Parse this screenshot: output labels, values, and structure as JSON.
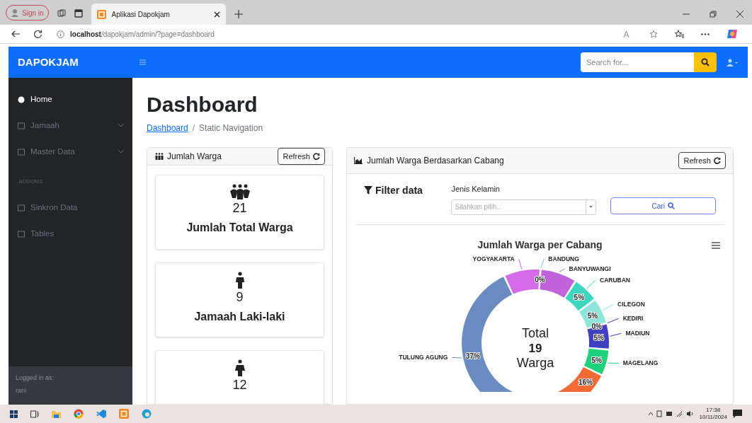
{
  "browser": {
    "sign_in": "Sign in",
    "tab_title": "Aplikasi Dapokjam",
    "url_host": "localhost",
    "url_path": "/dapokjam/admin/?page=dashboard"
  },
  "navbar": {
    "brand": "DAPOKJAM",
    "search": {
      "placeholder": "Search for..."
    }
  },
  "sidebar": {
    "items": [
      {
        "kind": "link",
        "label": "Home",
        "selected": true
      },
      {
        "kind": "collapse",
        "label": "Jamaah",
        "selected": false
      },
      {
        "kind": "collapse",
        "label": "Master Data",
        "selected": false
      },
      {
        "kind": "heading",
        "label": "ADDONS"
      },
      {
        "kind": "link",
        "label": "Sinkron Data",
        "selected": false
      },
      {
        "kind": "link",
        "label": "Tables",
        "selected": false
      }
    ],
    "footer": {
      "caption": "Logged in as:",
      "user": "rani"
    }
  },
  "page": {
    "title": "Dashboard",
    "breadcrumb_separator": "/",
    "breadcrumb": [
      {
        "label": "Dashboard",
        "kind": "link"
      },
      {
        "label": "Static Navigation",
        "kind": "current"
      }
    ]
  },
  "warga_card": {
    "title": "Jumlah Warga",
    "refresh": "Refresh",
    "stats": [
      {
        "kind": "group",
        "value": "21",
        "label": "Jumlah Total Warga"
      },
      {
        "kind": "male",
        "value": "9",
        "label": "Jamaah Laki-laki"
      },
      {
        "kind": "female",
        "value": "12"
      }
    ]
  },
  "cabang_card": {
    "title": "Jumlah Warga Berdasarkan Cabang",
    "refresh": "Refresh",
    "filter": {
      "heading": "Filter data",
      "field_label": "Jenis Kelamin",
      "placeholder": "Silahkan pilih..",
      "button": "Cari"
    },
    "chart_data": {
      "type": "donut",
      "title": "Jumlah Warga per Cabang",
      "categories": [
        "TULUNG AGUNG",
        "YOGYAKARTA",
        "BANDUNG",
        "BANYUWANGI",
        "CARUBAN",
        "CILEGON",
        "KEDIRI",
        "MADIUN",
        "MAGELANG",
        null
      ],
      "values": [
        37,
        7,
        0,
        7,
        5,
        5,
        0,
        5,
        5,
        16
      ],
      "value_labels": [
        "37%",
        null,
        "0%",
        null,
        "5%",
        "5%",
        "0%",
        "5%",
        "5%",
        "16%"
      ],
      "colors": [
        "#6b8cc0",
        "#d46ae8",
        "#7fc8e0",
        "#c062dc",
        "#3fd6c0",
        "#8ee6da",
        "#3f3fc0",
        "#3f3fc0",
        "#1ed17a",
        "#f46a35"
      ],
      "annotations": [
        {
          "text": "Total"
        },
        {
          "text": "19"
        },
        {
          "text": "Warga"
        }
      ]
    }
  },
  "taskbar": {
    "time": "17:38",
    "date": "10/11/2024"
  }
}
